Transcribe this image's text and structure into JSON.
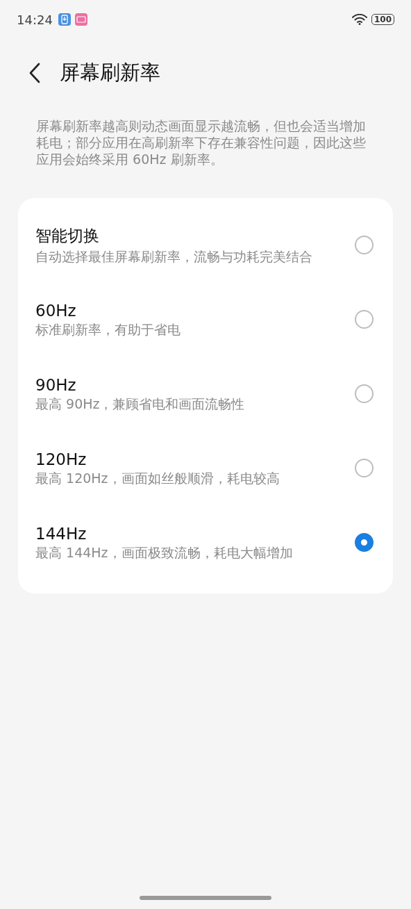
{
  "status_bar": {
    "time": "14:24",
    "battery": "100"
  },
  "header": {
    "title": "屏幕刷新率"
  },
  "description": "屏幕刷新率越高则动态画面显示越流畅，但也会适当增加耗电；部分应用在高刷新率下存在兼容性问题，因此这些应用会始终采用 60Hz 刷新率。",
  "options": [
    {
      "title": "智能切换",
      "subtitle": "自动选择最佳屏幕刷新率，流畅与功耗完美结合",
      "selected": false
    },
    {
      "title": "60Hz",
      "subtitle": "标准刷新率，有助于省电",
      "selected": false
    },
    {
      "title": "90Hz",
      "subtitle": "最高 90Hz，兼顾省电和画面流畅性",
      "selected": false
    },
    {
      "title": "120Hz",
      "subtitle": "最高 120Hz，画面如丝般顺滑，耗电较高",
      "selected": false
    },
    {
      "title": "144Hz",
      "subtitle": "最高 144Hz，画面极致流畅，耗电大幅增加",
      "selected": true
    }
  ]
}
